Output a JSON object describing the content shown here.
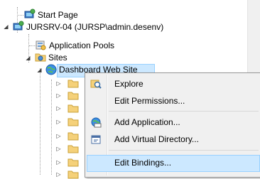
{
  "tree": {
    "start_page": "Start Page",
    "server": "JURSRV-04 (JURSP\\admin.desenv)",
    "app_pools": "Application Pools",
    "sites": "Sites",
    "selected_site": "Dashboard Web Site"
  },
  "context_menu": {
    "items": [
      {
        "label": "Explore",
        "icon": "explore-icon"
      },
      {
        "label": "Edit Permissions...",
        "icon": ""
      },
      {
        "label": "Add Application...",
        "icon": "add-application-icon"
      },
      {
        "label": "Add Virtual Directory...",
        "icon": "add-virtual-directory-icon"
      },
      {
        "label": "Edit Bindings...",
        "icon": ""
      }
    ],
    "hovered": "Edit Bindings..."
  },
  "colors": {
    "selection": "#cce8ff",
    "selection_border": "#99d1ff",
    "menu_bg": "#f0f0f0",
    "folder": "#f5d17a"
  }
}
